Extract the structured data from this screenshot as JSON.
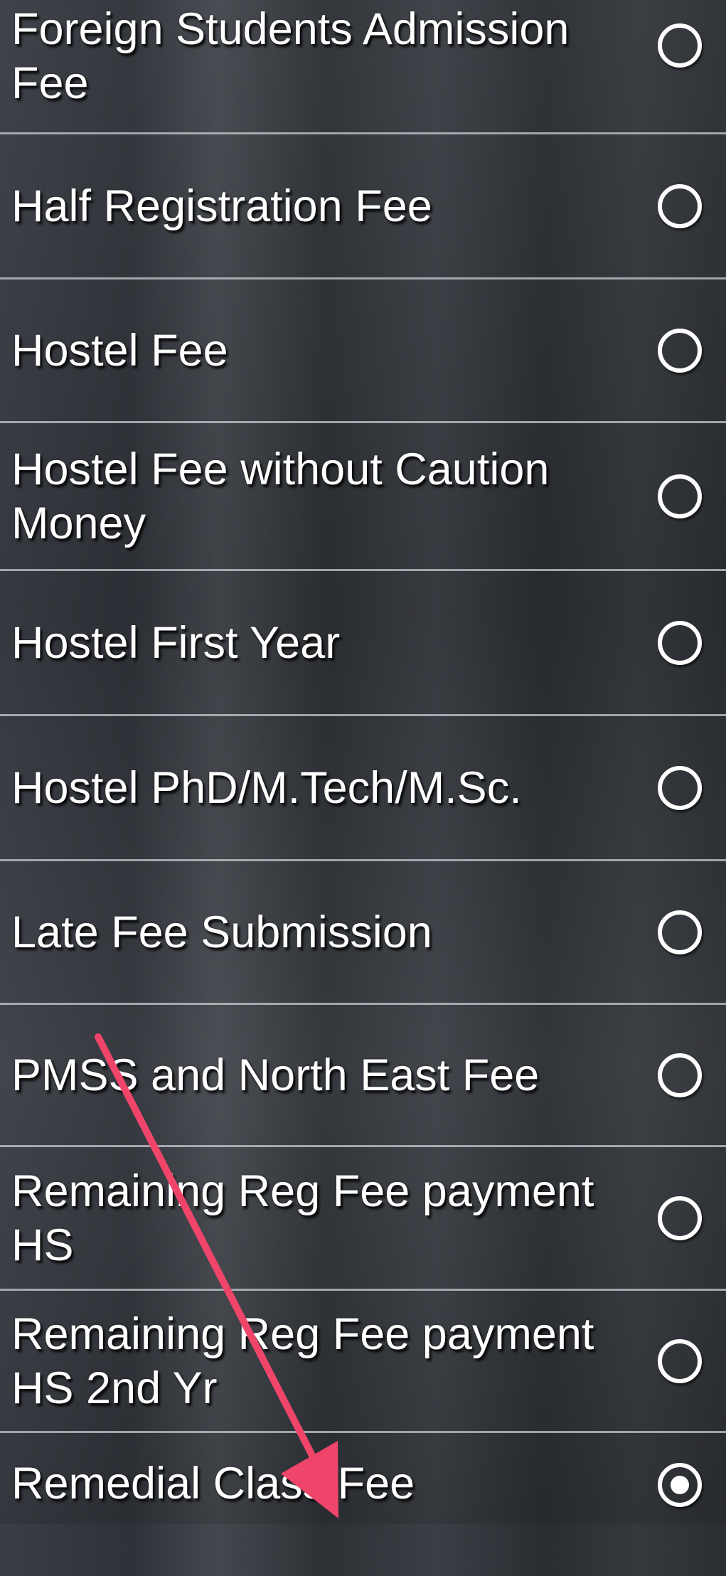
{
  "fee_options": [
    {
      "label": "Foreign Students Admission Fee",
      "selected": false
    },
    {
      "label": "Half Registration Fee",
      "selected": false
    },
    {
      "label": "Hostel Fee",
      "selected": false
    },
    {
      "label": "Hostel Fee without Caution Money",
      "selected": false
    },
    {
      "label": "Hostel First Year",
      "selected": false
    },
    {
      "label": "Hostel PhD/M.Tech/M.Sc.",
      "selected": false
    },
    {
      "label": "Late Fee Submission",
      "selected": false
    },
    {
      "label": "PMSS and North East Fee",
      "selected": false
    },
    {
      "label": "Remaining Reg Fee payment HS",
      "selected": false
    },
    {
      "label": "Remaining Reg Fee payment HS 2nd Yr",
      "selected": false
    },
    {
      "label": "Remedial Class Fee",
      "selected": true
    }
  ],
  "annotation": {
    "arrow_color": "#f0456b"
  }
}
